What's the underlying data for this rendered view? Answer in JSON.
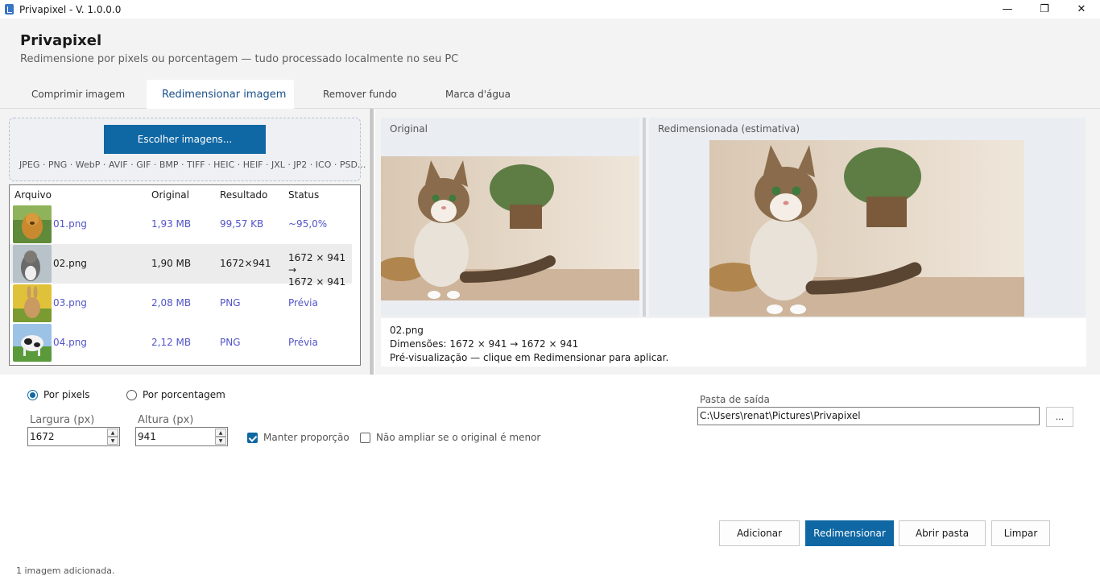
{
  "window": {
    "title": "Privapixel - V. 1.0.0.0",
    "minimize": "—",
    "maximize": "❐",
    "close": "✕"
  },
  "header": {
    "title": "Privapixel",
    "subtitle": "Redimensione por pixels ou porcentagem — tudo processado localmente no seu PC"
  },
  "tabs": [
    {
      "label": "Comprimir imagem"
    },
    {
      "label": "Redimensionar imagem"
    },
    {
      "label": "Remover fundo"
    },
    {
      "label": "Marca d'água"
    }
  ],
  "active_tab": "Redimensionar imagem",
  "dropzone": {
    "button_label": "Escolher imagens...",
    "formats": "JPEG · PNG · WebP · AVIF · GIF · BMP · TIFF · HEIC · HEIF · JXL · JP2 · ICO · PSD..."
  },
  "file_list": {
    "columns": {
      "file": "Arquivo",
      "original": "Original",
      "result": "Resultado",
      "status": "Status"
    },
    "rows": [
      {
        "name": "01.png",
        "original": "1,93 MB",
        "result": "99,57 KB",
        "status": "~95,0%",
        "status_line2": ""
      },
      {
        "name": "02.png",
        "original": "1,90 MB",
        "result": "1672×941",
        "status": "1672 × 941 →",
        "status_line2": "1672 × 941"
      },
      {
        "name": "03.png",
        "original": "2,08 MB",
        "result": "PNG",
        "status": "Prévia",
        "status_line2": ""
      },
      {
        "name": "04.png",
        "original": "2,12 MB",
        "result": "PNG",
        "status": "Prévia",
        "status_line2": ""
      }
    ]
  },
  "preview": {
    "original_label": "Original",
    "resized_label": "Redimensionada (estimativa)",
    "filename": "02.png",
    "dimensions": "Dimensões: 1672 × 941 → 1672 × 941",
    "hint": "Pré-visualização — clique em Redimensionar para aplicar."
  },
  "options": {
    "by_pixels": "Por pixels",
    "by_percent": "Por porcentagem",
    "width_label": "Largura (px)",
    "width_value": "1672",
    "height_label": "Altura (px)",
    "height_value": "941",
    "keep_ratio": "Manter proporção",
    "no_upscale": "Não ampliar se o original é menor",
    "output_label": "Pasta de saída",
    "output_path": "C:\\Users\\renat\\Pictures\\Privapixel",
    "browse_label": "..."
  },
  "actions": {
    "add": "Adicionar",
    "resize": "Redimensionar",
    "open_folder": "Abrir pasta",
    "clear": "Limpar"
  },
  "status": "1 imagem adicionada.",
  "colors": {
    "accent": "#0f67a3",
    "link": "#5254c8"
  }
}
